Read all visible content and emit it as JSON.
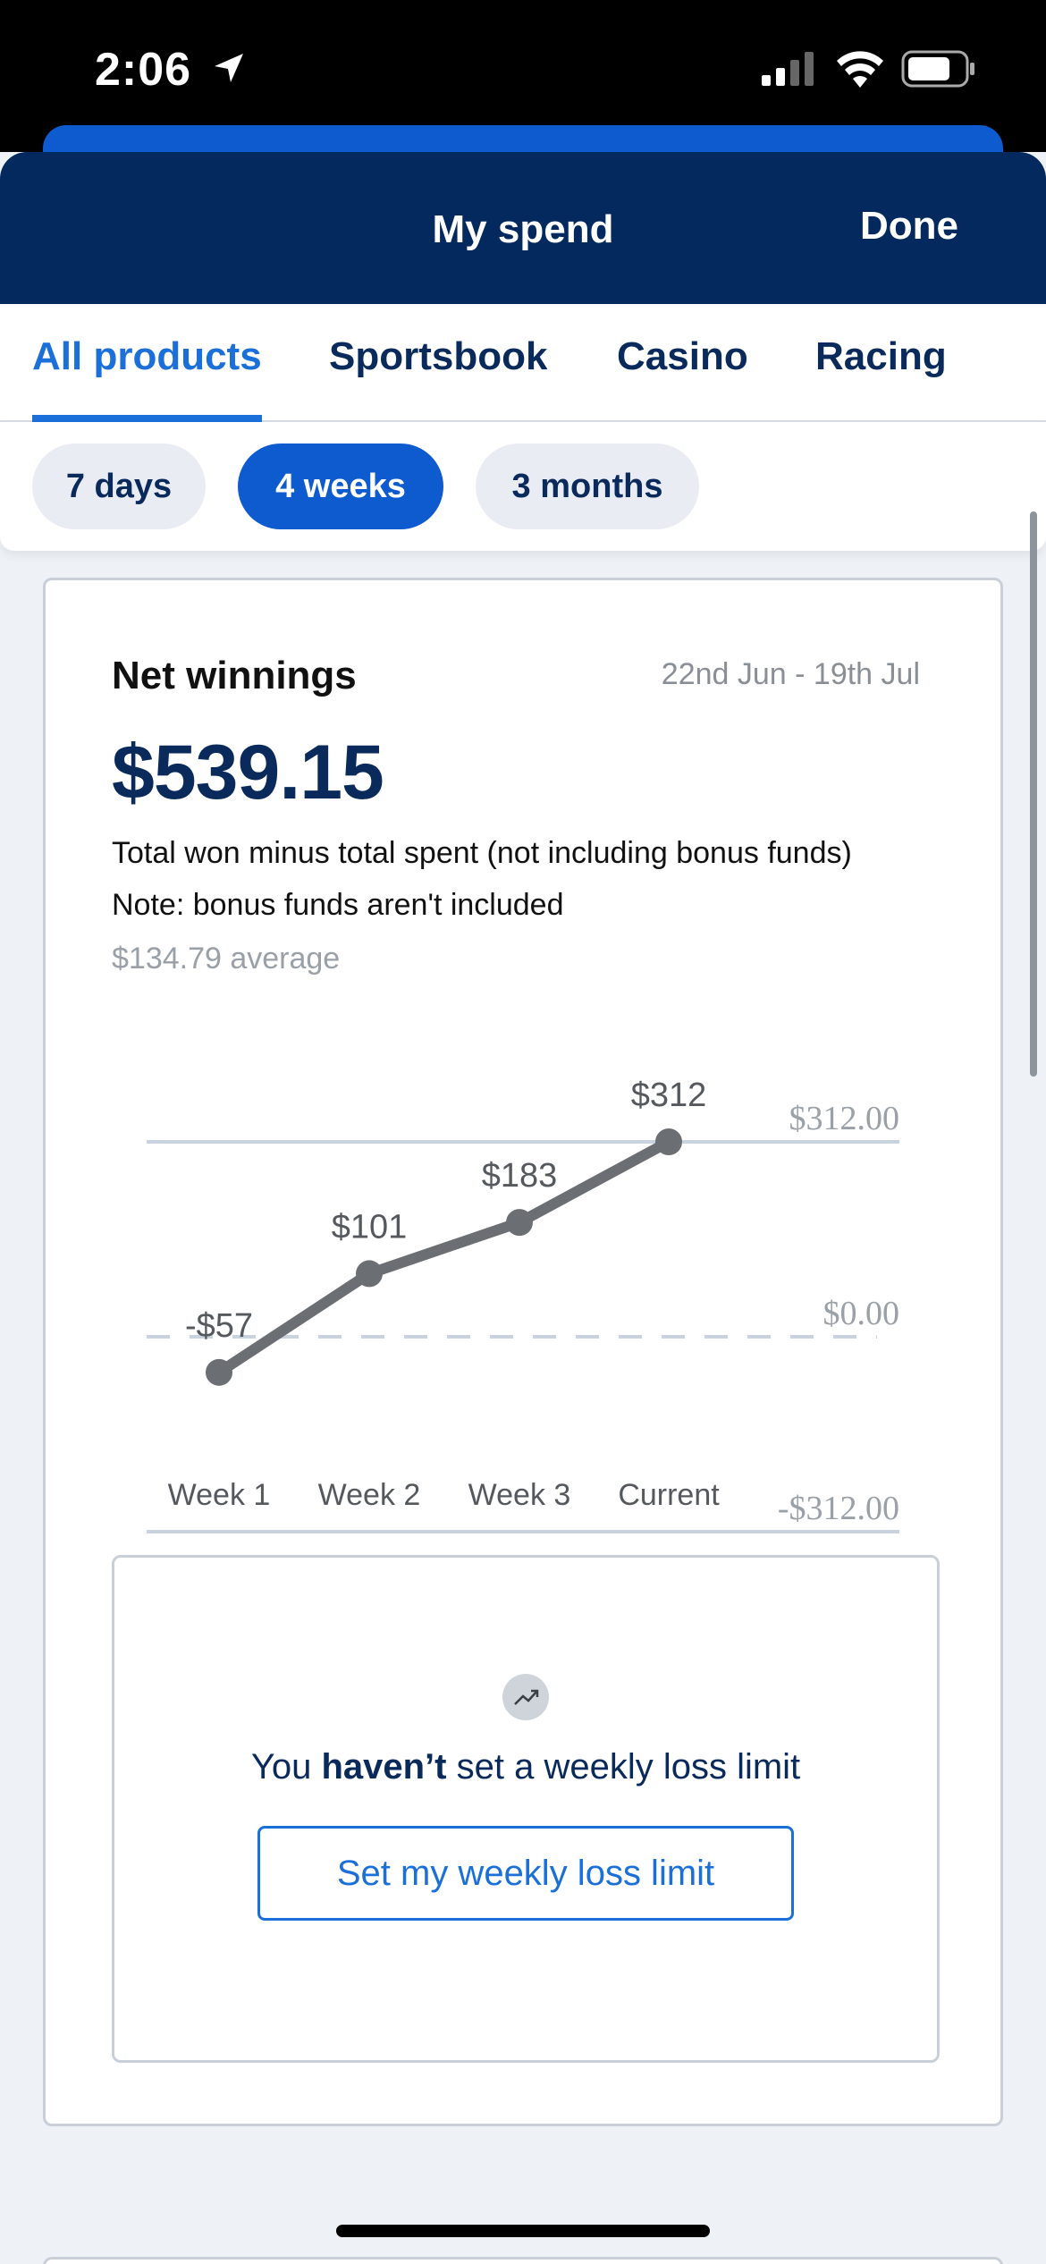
{
  "status_bar": {
    "time": "2:06"
  },
  "header": {
    "title": "My spend",
    "done_label": "Done"
  },
  "tabs": [
    {
      "label": "All products",
      "active": true
    },
    {
      "label": "Sportsbook",
      "active": false
    },
    {
      "label": "Casino",
      "active": false
    },
    {
      "label": "Racing",
      "active": false
    }
  ],
  "periods": [
    {
      "label": "7 days",
      "active": false
    },
    {
      "label": "4 weeks",
      "active": true
    },
    {
      "label": "3 months",
      "active": false
    }
  ],
  "card": {
    "title": "Net winnings",
    "date_range": "22nd Jun - 19th Jul",
    "amount": "$539.15",
    "description": "Total won minus total spent (not including bonus funds)",
    "note": "Note: bonus funds aren't included",
    "average": "$134.79 average"
  },
  "chart_data": {
    "type": "line",
    "categories": [
      "Week 1",
      "Week 2",
      "Week 3",
      "Current"
    ],
    "values": [
      -57,
      101,
      183,
      312
    ],
    "data_labels": [
      "-$57",
      "$101",
      "$183",
      "$312"
    ],
    "y_tick_labels": [
      "$312.00",
      "$0.00",
      "-$312.00"
    ],
    "y_ticks": [
      312,
      0,
      -312
    ],
    "ylim": [
      -312,
      312
    ],
    "zero_line": "dashed",
    "line_color": "#6b6e72",
    "grid_color": "#c9d3e0"
  },
  "limit": {
    "text_prefix": "You ",
    "text_bold": "haven’t",
    "text_suffix": " set a weekly loss limit",
    "button_label": "Set my weekly loss limit",
    "icon": "trend-up-icon"
  },
  "colors": {
    "header_bg": "#04295e",
    "accent": "#1b6fd9",
    "pill_active": "#0d5bcf"
  }
}
